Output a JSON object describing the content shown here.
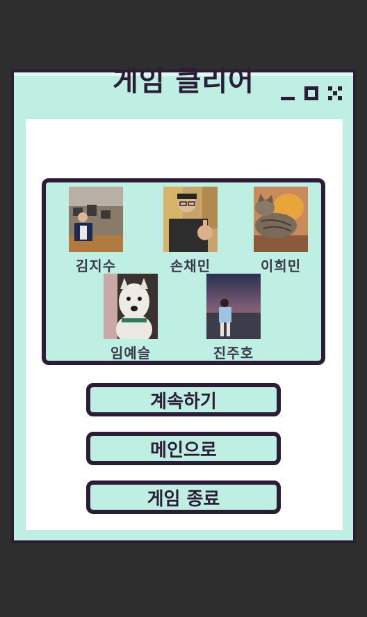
{
  "window": {
    "controls": {
      "minimize": "minimize-icon",
      "maximize": "maximize-icon",
      "close": "close-icon"
    }
  },
  "title": "게임 클리어",
  "members": [
    {
      "name": "김지수",
      "photo": "person-in-cafe-photo"
    },
    {
      "name": "손채민",
      "photo": "person-thumbs-up-photo"
    },
    {
      "name": "이희민",
      "photo": "sleeping-cat-photo"
    },
    {
      "name": "임예슬",
      "photo": "white-dog-photo"
    },
    {
      "name": "진주호",
      "photo": "person-at-sunset-photo"
    }
  ],
  "buttons": {
    "continue": "계속하기",
    "main": "메인으로",
    "quit": "게임 종료"
  },
  "colors": {
    "background": "#2e2e2e",
    "accent": "#bfeee3",
    "border": "#2c1d36",
    "panel": "#ffffff"
  }
}
